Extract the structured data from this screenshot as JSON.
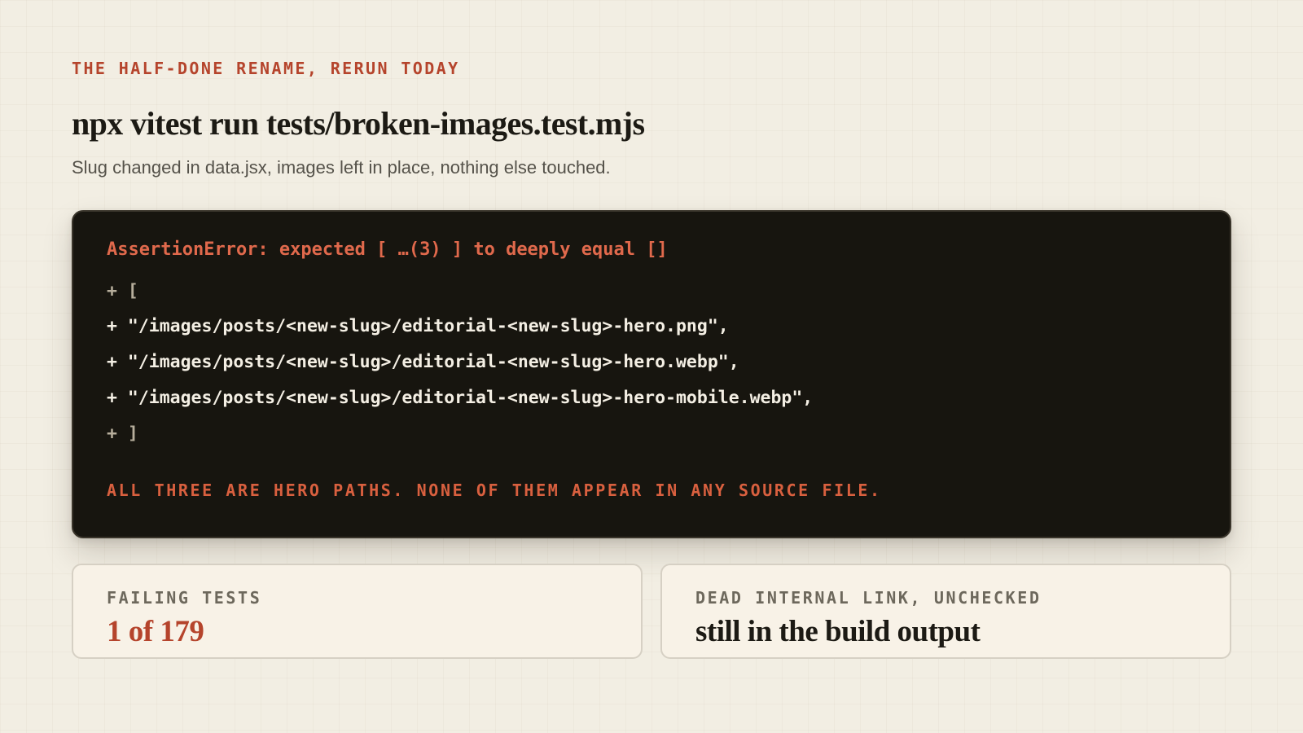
{
  "header": {
    "eyebrow": "THE HALF-DONE RENAME, RERUN TODAY",
    "title": "npx vitest run tests/broken-images.test.mjs",
    "subtitle": "Slug changed in data.jsx, images left in place, nothing else touched."
  },
  "terminal": {
    "error": "AssertionError: expected [ …(3) ] to deeply equal []",
    "diff_lines": [
      "+ [",
      "+ \"/images/posts/<new-slug>/editorial-<new-slug>-hero.png\",",
      "+ \"/images/posts/<new-slug>/editorial-<new-slug>-hero.webp\",",
      "+ \"/images/posts/<new-slug>/editorial-<new-slug>-hero-mobile.webp\",",
      "+ ]"
    ],
    "note": "ALL THREE ARE HERO PATHS. NONE OF THEM APPEAR IN ANY SOURCE FILE."
  },
  "cards": {
    "failing": {
      "label": "FAILING TESTS",
      "value": "1 of 179"
    },
    "dead_link": {
      "label": "DEAD INTERNAL LINK, UNCHECKED",
      "value": "still in the build output"
    }
  },
  "colors": {
    "background": "#f2eee3",
    "accent": "#b5442c",
    "terminal_bg": "#17150f",
    "terminal_error": "#e0694c",
    "card_bg": "#f8f2e7"
  }
}
